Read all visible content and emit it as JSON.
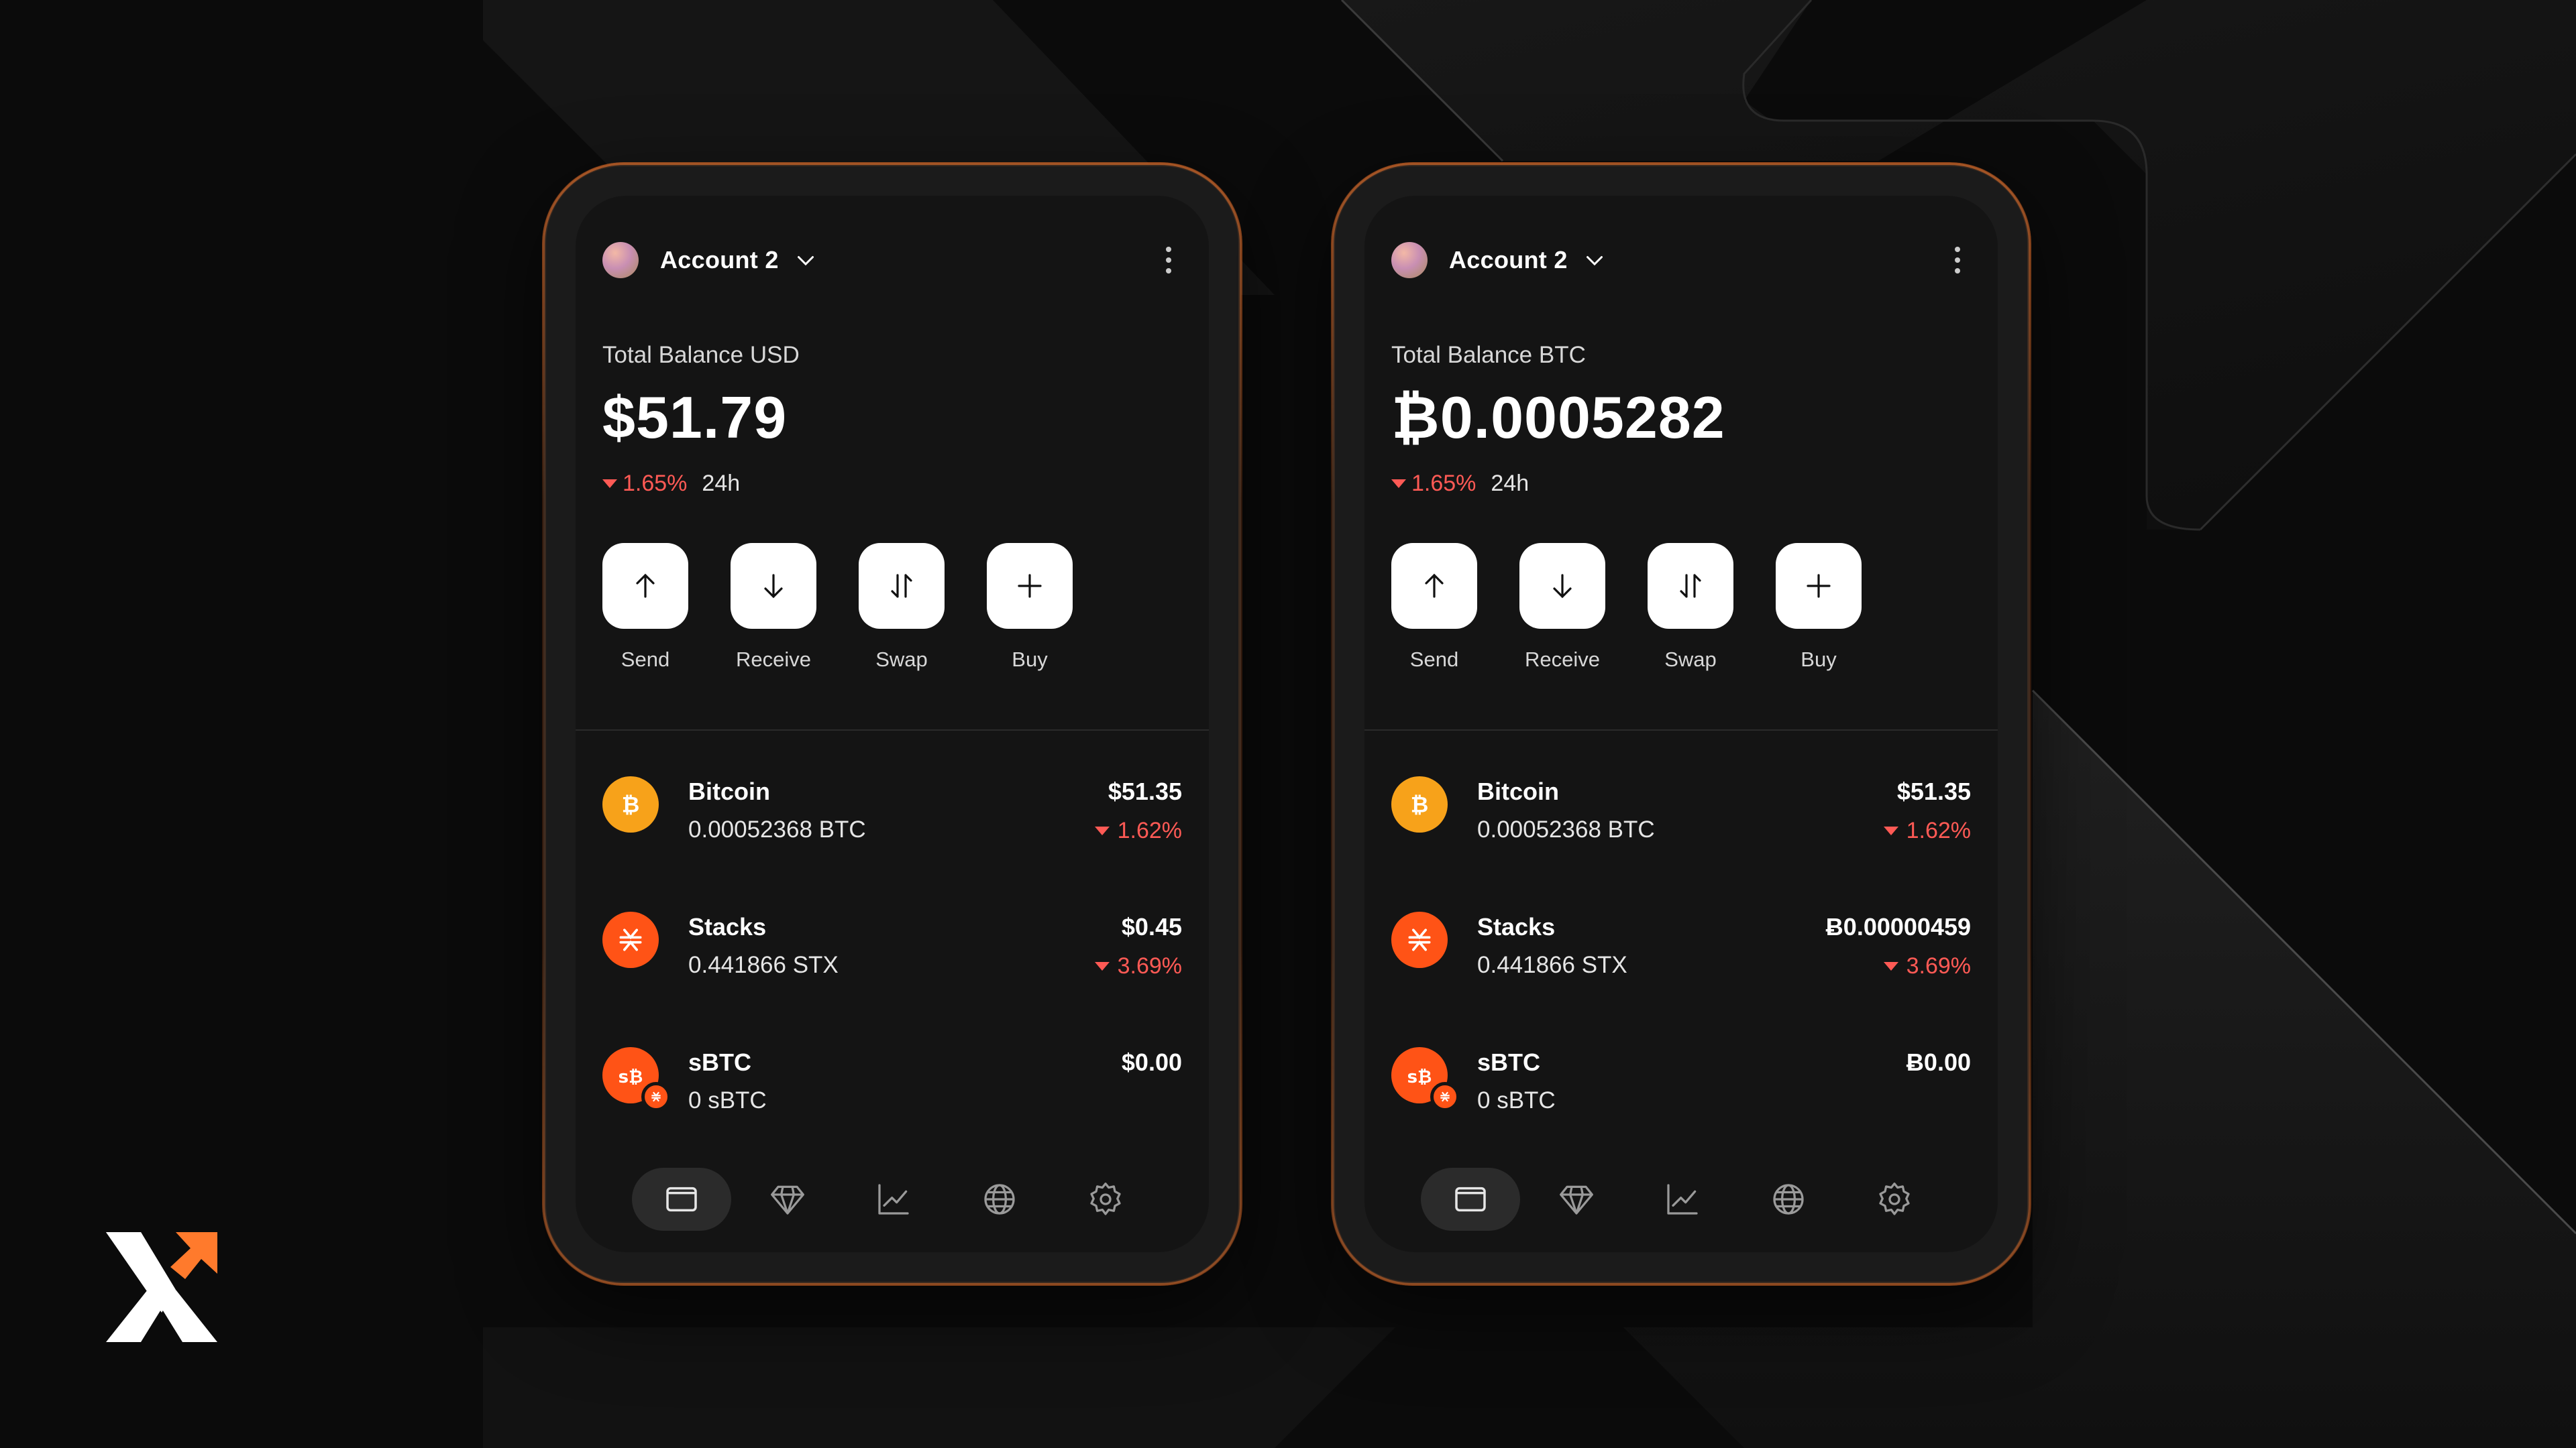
{
  "colors": {
    "background": "#0c0c0c",
    "screen": "#141414",
    "accent": "#ff5316",
    "bitcoin": "#f7a21a",
    "negative": "#ff5a55"
  },
  "wallets": [
    {
      "account_name": "Account 2",
      "balance_label": "Total Balance USD",
      "balance_value": "$51.79",
      "change_pct": "1.65%",
      "change_period": "24h",
      "actions": [
        "Send",
        "Receive",
        "Swap",
        "Buy"
      ],
      "assets": [
        {
          "name": "Bitcoin",
          "amount": "0.00052368 BTC",
          "value": "$51.35",
          "change": "1.62%"
        },
        {
          "name": "Stacks",
          "amount": "0.441866 STX",
          "value": "$0.45",
          "change": "3.69%"
        },
        {
          "name": "sBTC",
          "amount": "0 sBTC",
          "value": "$0.00",
          "change": ""
        }
      ]
    },
    {
      "account_name": "Account 2",
      "balance_label": "Total Balance BTC",
      "balance_value": "₿0.0005282",
      "change_pct": "1.65%",
      "change_period": "24h",
      "actions": [
        "Send",
        "Receive",
        "Swap",
        "Buy"
      ],
      "assets": [
        {
          "name": "Bitcoin",
          "amount": "0.00052368 BTC",
          "value": "$51.35",
          "change": "1.62%"
        },
        {
          "name": "Stacks",
          "amount": "0.441866 STX",
          "value": "Ƀ0.00000459",
          "change": "3.69%"
        },
        {
          "name": "sBTC",
          "amount": "0 sBTC",
          "value": "Ƀ0.00",
          "change": ""
        }
      ]
    }
  ],
  "icons": {
    "account": "avatar",
    "dropdown": "chevron-down-icon",
    "menu": "more-vertical-icon",
    "send": "arrow-up-icon",
    "receive": "arrow-down-icon",
    "swap": "swap-icon",
    "buy": "plus-icon",
    "nav": [
      "wallet-icon",
      "diamond-icon",
      "chart-icon",
      "globe-icon",
      "gear-icon"
    ]
  }
}
